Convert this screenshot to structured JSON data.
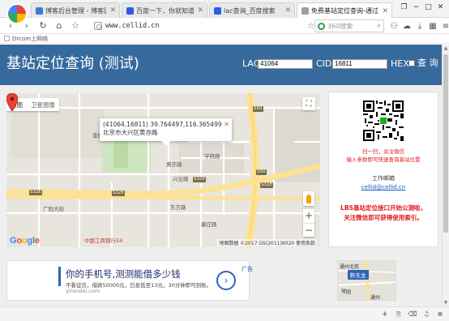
{
  "browser": {
    "tabs": [
      {
        "label": "博客后台管理 - 博客园",
        "favicon_color": "#3a7bd5",
        "active": false
      },
      {
        "label": "百度一下，你就知道",
        "favicon_color": "#2d5be3",
        "active": false
      },
      {
        "label": "lac查询_百度搜索",
        "favicon_color": "#2d5be3",
        "active": false
      },
      {
        "label": "免费基站定位查询-通过基站",
        "favicon_color": "#9aa0a6",
        "active": true
      }
    ],
    "url": "www.cellid.cn",
    "search_placeholder": "360搜索",
    "bookmark": "Drcom上网络"
  },
  "header": {
    "title": "基站定位查询 (测试)",
    "lac_label": "LAC:",
    "lac_value": "41064",
    "cid_label": "CID:",
    "cid_value": "16811",
    "hex_label": "HEX:",
    "query_label": "查 询",
    "background_color": "#376a9c"
  },
  "map": {
    "type_buttons": [
      "地图",
      "卫星图像"
    ],
    "info_line1": "(41064,16811) 39.764497,116.365499",
    "info_line2": "北京市大兴区黄亦路",
    "attribution": "地图数据 ©2017 GS(2011)6020   使用条款",
    "google_logo": "Google",
    "pois": [
      "中国工商银行24",
      "黄亦路",
      "兴业路",
      "学府路",
      "东方路",
      "康庄路",
      "广阳大街",
      "金星路"
    ],
    "road_shields": [
      "S50",
      "S50",
      "S32E",
      "S32E",
      "S32E",
      "S32E"
    ],
    "zoom_in": "+",
    "zoom_out": "−"
  },
  "side_panel": {
    "scan_line1": "扫一扫，关注微信",
    "scan_line2": "输入参数即可快速查询基站位置",
    "email_label": "工作邮箱",
    "email": "cellid@cellid.cn",
    "lbs_line1": "LBS基站定位接口开始公测啦，",
    "lbs_line2": "关注微信即可获得使用索引。"
  },
  "ad": {
    "title": "你的手机号,测测能借多少钱",
    "desc": "不看征信，借款50000元，日息低至13元，30分钟即可到账。",
    "url": "yirendai.com",
    "tag": "广告",
    "map_tag": "黔东龙",
    "map_labels": [
      "通州北苑",
      "琴园",
      "通州"
    ]
  }
}
